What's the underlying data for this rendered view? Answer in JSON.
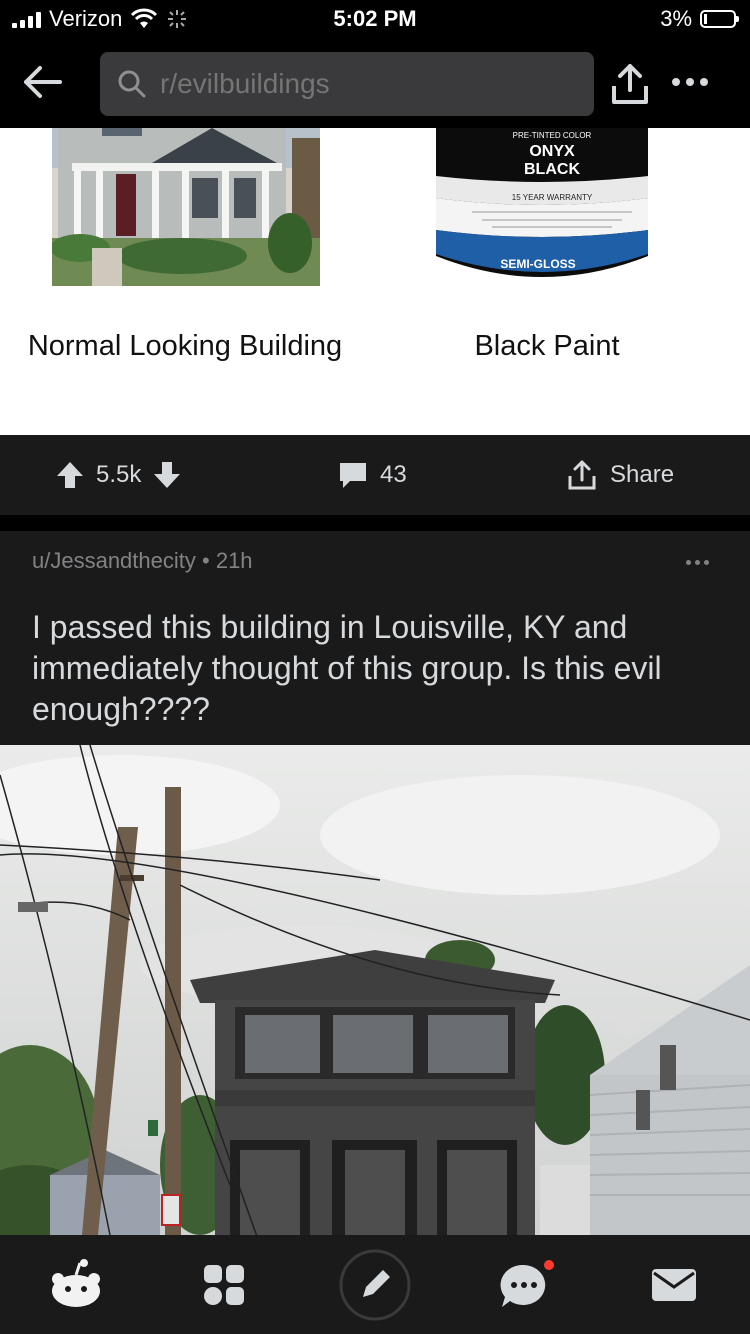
{
  "status_bar": {
    "carrier": "Verizon",
    "time": "5:02 PM",
    "battery": "3%"
  },
  "nav": {
    "search_placeholder": "r/evilbuildings"
  },
  "meme": {
    "left_caption": "Normal Looking Building",
    "right_caption": "Black Paint",
    "paint_can": {
      "line1": "PRE-TINTED COLOR",
      "line2": "ONYX",
      "line3": "BLACK",
      "warranty": "15 YEAR WARRANTY",
      "finish": "SEMI-GLOSS"
    }
  },
  "actions": {
    "votes": "5.5k",
    "comments": "43",
    "share": "Share"
  },
  "post": {
    "author": "u/Jessandthecity",
    "age": "21h",
    "title": "I passed this building in Louisville, KY and immediately thought of this group. Is this evil enough????"
  },
  "colors": {
    "background": "#1a1a1b",
    "black": "#000000",
    "text": "#d7dadc",
    "muted": "#818384",
    "notification": "#ff3b30"
  }
}
